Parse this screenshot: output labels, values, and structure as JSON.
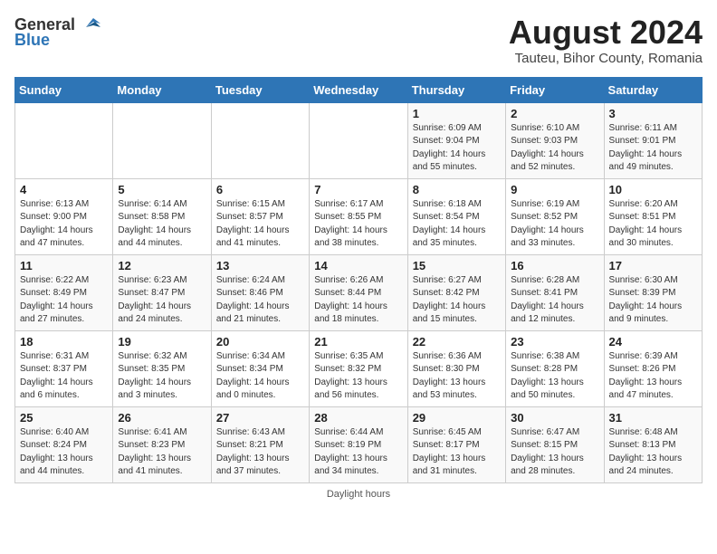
{
  "header": {
    "logo_general": "General",
    "logo_blue": "Blue",
    "month_year": "August 2024",
    "location": "Tauteu, Bihor County, Romania"
  },
  "footer": {
    "note": "Daylight hours"
  },
  "weekdays": [
    "Sunday",
    "Monday",
    "Tuesday",
    "Wednesday",
    "Thursday",
    "Friday",
    "Saturday"
  ],
  "weeks": [
    [
      {
        "day": "",
        "info": ""
      },
      {
        "day": "",
        "info": ""
      },
      {
        "day": "",
        "info": ""
      },
      {
        "day": "",
        "info": ""
      },
      {
        "day": "1",
        "info": "Sunrise: 6:09 AM\nSunset: 9:04 PM\nDaylight: 14 hours\nand 55 minutes."
      },
      {
        "day": "2",
        "info": "Sunrise: 6:10 AM\nSunset: 9:03 PM\nDaylight: 14 hours\nand 52 minutes."
      },
      {
        "day": "3",
        "info": "Sunrise: 6:11 AM\nSunset: 9:01 PM\nDaylight: 14 hours\nand 49 minutes."
      }
    ],
    [
      {
        "day": "4",
        "info": "Sunrise: 6:13 AM\nSunset: 9:00 PM\nDaylight: 14 hours\nand 47 minutes."
      },
      {
        "day": "5",
        "info": "Sunrise: 6:14 AM\nSunset: 8:58 PM\nDaylight: 14 hours\nand 44 minutes."
      },
      {
        "day": "6",
        "info": "Sunrise: 6:15 AM\nSunset: 8:57 PM\nDaylight: 14 hours\nand 41 minutes."
      },
      {
        "day": "7",
        "info": "Sunrise: 6:17 AM\nSunset: 8:55 PM\nDaylight: 14 hours\nand 38 minutes."
      },
      {
        "day": "8",
        "info": "Sunrise: 6:18 AM\nSunset: 8:54 PM\nDaylight: 14 hours\nand 35 minutes."
      },
      {
        "day": "9",
        "info": "Sunrise: 6:19 AM\nSunset: 8:52 PM\nDaylight: 14 hours\nand 33 minutes."
      },
      {
        "day": "10",
        "info": "Sunrise: 6:20 AM\nSunset: 8:51 PM\nDaylight: 14 hours\nand 30 minutes."
      }
    ],
    [
      {
        "day": "11",
        "info": "Sunrise: 6:22 AM\nSunset: 8:49 PM\nDaylight: 14 hours\nand 27 minutes."
      },
      {
        "day": "12",
        "info": "Sunrise: 6:23 AM\nSunset: 8:47 PM\nDaylight: 14 hours\nand 24 minutes."
      },
      {
        "day": "13",
        "info": "Sunrise: 6:24 AM\nSunset: 8:46 PM\nDaylight: 14 hours\nand 21 minutes."
      },
      {
        "day": "14",
        "info": "Sunrise: 6:26 AM\nSunset: 8:44 PM\nDaylight: 14 hours\nand 18 minutes."
      },
      {
        "day": "15",
        "info": "Sunrise: 6:27 AM\nSunset: 8:42 PM\nDaylight: 14 hours\nand 15 minutes."
      },
      {
        "day": "16",
        "info": "Sunrise: 6:28 AM\nSunset: 8:41 PM\nDaylight: 14 hours\nand 12 minutes."
      },
      {
        "day": "17",
        "info": "Sunrise: 6:30 AM\nSunset: 8:39 PM\nDaylight: 14 hours\nand 9 minutes."
      }
    ],
    [
      {
        "day": "18",
        "info": "Sunrise: 6:31 AM\nSunset: 8:37 PM\nDaylight: 14 hours\nand 6 minutes."
      },
      {
        "day": "19",
        "info": "Sunrise: 6:32 AM\nSunset: 8:35 PM\nDaylight: 14 hours\nand 3 minutes."
      },
      {
        "day": "20",
        "info": "Sunrise: 6:34 AM\nSunset: 8:34 PM\nDaylight: 14 hours\nand 0 minutes."
      },
      {
        "day": "21",
        "info": "Sunrise: 6:35 AM\nSunset: 8:32 PM\nDaylight: 13 hours\nand 56 minutes."
      },
      {
        "day": "22",
        "info": "Sunrise: 6:36 AM\nSunset: 8:30 PM\nDaylight: 13 hours\nand 53 minutes."
      },
      {
        "day": "23",
        "info": "Sunrise: 6:38 AM\nSunset: 8:28 PM\nDaylight: 13 hours\nand 50 minutes."
      },
      {
        "day": "24",
        "info": "Sunrise: 6:39 AM\nSunset: 8:26 PM\nDaylight: 13 hours\nand 47 minutes."
      }
    ],
    [
      {
        "day": "25",
        "info": "Sunrise: 6:40 AM\nSunset: 8:24 PM\nDaylight: 13 hours\nand 44 minutes."
      },
      {
        "day": "26",
        "info": "Sunrise: 6:41 AM\nSunset: 8:23 PM\nDaylight: 13 hours\nand 41 minutes."
      },
      {
        "day": "27",
        "info": "Sunrise: 6:43 AM\nSunset: 8:21 PM\nDaylight: 13 hours\nand 37 minutes."
      },
      {
        "day": "28",
        "info": "Sunrise: 6:44 AM\nSunset: 8:19 PM\nDaylight: 13 hours\nand 34 minutes."
      },
      {
        "day": "29",
        "info": "Sunrise: 6:45 AM\nSunset: 8:17 PM\nDaylight: 13 hours\nand 31 minutes."
      },
      {
        "day": "30",
        "info": "Sunrise: 6:47 AM\nSunset: 8:15 PM\nDaylight: 13 hours\nand 28 minutes."
      },
      {
        "day": "31",
        "info": "Sunrise: 6:48 AM\nSunset: 8:13 PM\nDaylight: 13 hours\nand 24 minutes."
      }
    ]
  ]
}
